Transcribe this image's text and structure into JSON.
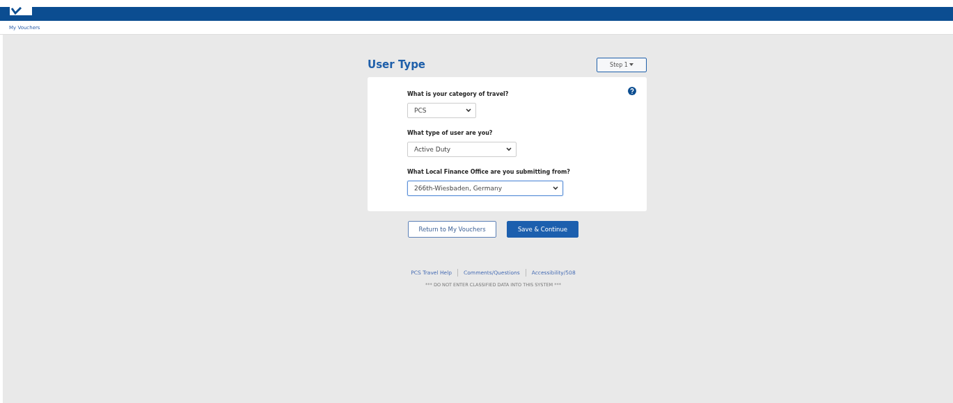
{
  "breadcrumb": {
    "label": "My Vouchers"
  },
  "page": {
    "title": "User Type",
    "step_button": "Step 1"
  },
  "fields": [
    {
      "label": "What is your category of travel?",
      "value": "PCS",
      "focused": false
    },
    {
      "label": "What type of user are you?",
      "value": "Active Duty",
      "focused": false
    },
    {
      "label": "What Local Finance Office are you submitting from?",
      "value": "266th-Wiesbaden, Germany",
      "focused": true
    }
  ],
  "buttons": [
    {
      "label": "Return to My Vouchers",
      "kind": "secondary"
    },
    {
      "label": "Save & Continue",
      "kind": "primary"
    }
  ],
  "footer_links": [
    "PCS Travel Help",
    "Comments/Questions",
    "Accessibility/508"
  ],
  "footer_notice": "*** DO NOT ENTER CLASSIFIED DATA INTO THIS SYSTEM ***"
}
